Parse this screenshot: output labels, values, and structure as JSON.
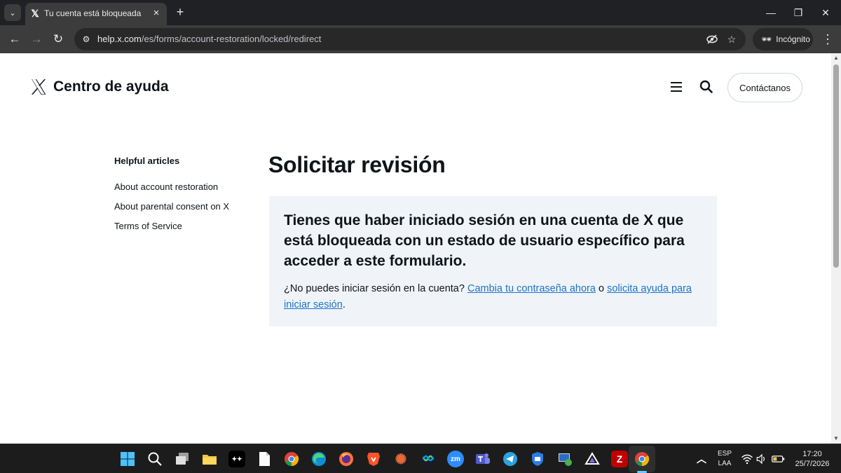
{
  "browser": {
    "tab_title": "Tu cuenta está bloqueada",
    "url_host": "help.x.com",
    "url_path": "/es/forms/account-restoration/locked/redirect",
    "incognito_label": "Incógnito"
  },
  "header": {
    "site_title": "Centro de ayuda",
    "contact_label": "Contáctanos"
  },
  "sidebar": {
    "heading": "Helpful articles",
    "items": [
      {
        "label": "About account restoration"
      },
      {
        "label": "About parental consent on X"
      },
      {
        "label": "Terms of Service"
      }
    ]
  },
  "main": {
    "title": "Solicitar revisión",
    "notice_heading": "Tienes que haber iniciado sesión en una cuenta de X que está bloqueada con un estado de usuario específico para acceder a este formulario.",
    "text_before": "¿No puedes iniciar sesión en la cuenta? ",
    "link_change_password": "Cambia tu contraseña ahora",
    "text_or": " o ",
    "link_login_help": "solicita ayuda para iniciar sesión",
    "text_end": "."
  },
  "taskbar": {
    "lang_top": "ESP",
    "lang_bottom": "LAA",
    "time": "17:20",
    "date": "25/7/2026",
    "apps": [
      {
        "name": "start-icon"
      },
      {
        "name": "search-icon"
      },
      {
        "name": "task-view-icon"
      },
      {
        "name": "file-explorer-icon"
      },
      {
        "name": "tidal-icon"
      },
      {
        "name": "notepad-icon"
      },
      {
        "name": "chrome-icon"
      },
      {
        "name": "edge-icon"
      },
      {
        "name": "firefox-icon"
      },
      {
        "name": "brave-icon"
      },
      {
        "name": "starburst-app-icon"
      },
      {
        "name": "webex-icon"
      },
      {
        "name": "zoom-icon"
      },
      {
        "name": "teams-icon"
      },
      {
        "name": "telegram-icon"
      },
      {
        "name": "shield-app-icon"
      },
      {
        "name": "remote-desktop-icon"
      },
      {
        "name": "proton-icon"
      },
      {
        "name": "filezilla-icon"
      },
      {
        "name": "chrome-incognito-icon"
      }
    ]
  },
  "colors": {
    "link": "#1d73c9",
    "notice_bg": "#f0f4f8",
    "text": "#0f1419",
    "taskbar_bg": "#1c1c1c",
    "chrome_dark": "#202124"
  }
}
